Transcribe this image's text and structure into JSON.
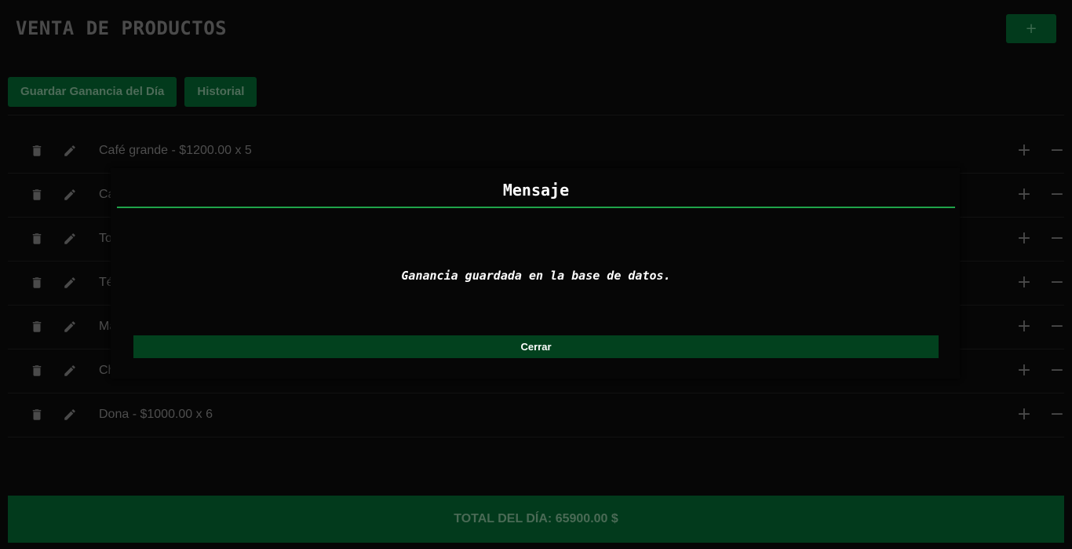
{
  "header": {
    "title": "VENTA DE PRODUCTOS",
    "add_label": "+"
  },
  "actions": {
    "save_label": "Guardar Ganancia del Día",
    "history_label": "Historial"
  },
  "products": [
    {
      "label": "Café grande - $1200.00 x 5"
    },
    {
      "label": "Ca"
    },
    {
      "label": "To"
    },
    {
      "label": "Té"
    },
    {
      "label": "Ma"
    },
    {
      "label": "Ch"
    },
    {
      "label": "Dona - $1000.00 x 6"
    }
  ],
  "row_controls": {
    "plus": "+",
    "minus": "−"
  },
  "total": {
    "label": "TOTAL DEL DÍA: 65900.00 $"
  },
  "modal": {
    "title": "Mensaje",
    "message": "Ganancia guardada en la base de datos.",
    "close_label": "Cerrar"
  },
  "icons": {
    "trash": "trash-icon",
    "edit": "pencil-icon"
  },
  "colors": {
    "accent_green": "#023a1c",
    "modal_line": "#1fa34a",
    "background": "#060606"
  }
}
